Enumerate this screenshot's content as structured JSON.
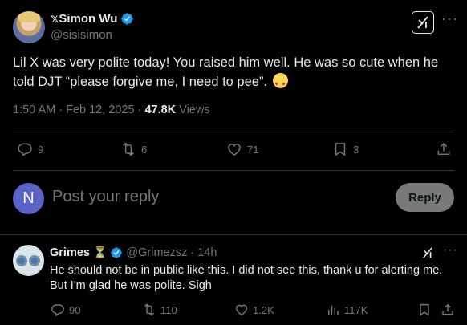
{
  "post": {
    "display_name": "𝕩Simon Wu",
    "handle": "@sisisimon",
    "text": "Lil X was very polite today!  You raised him well.  He was so cute when he told DJT “please forgive me, I need to pee”.",
    "emoji_icon": "smiling-face-with-hearts-icon",
    "timestamp": "1:50 AM · Feb 12, 2025 · ",
    "views_count": "47.8K",
    "views_label": " Views",
    "stats": {
      "replies": "9",
      "reposts": "6",
      "likes": "71",
      "bookmarks": "3"
    }
  },
  "reply_box": {
    "avatar_letter": "N",
    "placeholder": "Post your reply",
    "button_label": "Reply"
  },
  "comment": {
    "display_name": "Grimes",
    "name_badge": "⏳",
    "handle": "@Grimezsz",
    "separator": "·",
    "time": "14h",
    "text": "He should not be in public like this.  I did not see this, thank u for alerting me.  But I'm glad he was polite.  Sigh",
    "stats": {
      "replies": "90",
      "reposts": "110",
      "likes": "1.2K",
      "views": "117K"
    }
  },
  "colors": {
    "background": "#000000",
    "text": "#e7e9ea",
    "muted": "#71767b",
    "verified": "#1d9bf0",
    "reply_avatar": "#5b63c8",
    "reply_button": "#787a7a"
  }
}
